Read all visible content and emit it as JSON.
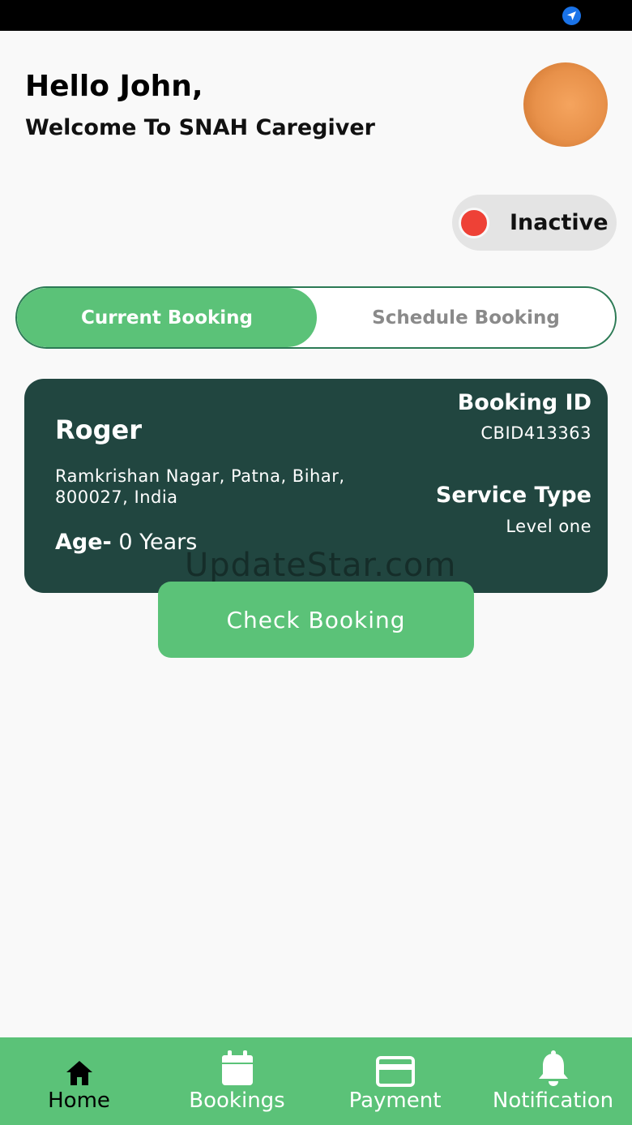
{
  "header": {
    "greeting": "Hello John,",
    "welcome": "Welcome To SNAH Caregiver"
  },
  "status": {
    "label": "Inactive",
    "dot_color": "#ee4136"
  },
  "tabs": [
    {
      "label": "Current Booking",
      "active": true
    },
    {
      "label": "Schedule Booking",
      "active": false
    }
  ],
  "booking": {
    "patient_name": "Roger",
    "address": "Ramkrishan Nagar, Patna, Bihar, 800027, India",
    "age_label": "Age-",
    "age_value": " 0 Years",
    "booking_id_label": "Booking ID",
    "booking_id": "CBID413363",
    "service_type_label": "Service Type",
    "service_type": "Level one"
  },
  "watermark": "UpdateStar.com",
  "check_button_label": "Check Booking",
  "nav": [
    {
      "label": "Home",
      "icon": "home-icon",
      "active": true
    },
    {
      "label": "Bookings",
      "icon": "calendar-icon",
      "active": false
    },
    {
      "label": "Payment",
      "icon": "credit-card-icon",
      "active": false
    },
    {
      "label": "Notification",
      "icon": "bell-icon",
      "active": false
    }
  ],
  "colors": {
    "accent_green": "#5bc278",
    "card_dark": "#214640",
    "tab_border": "#2c7a55"
  }
}
